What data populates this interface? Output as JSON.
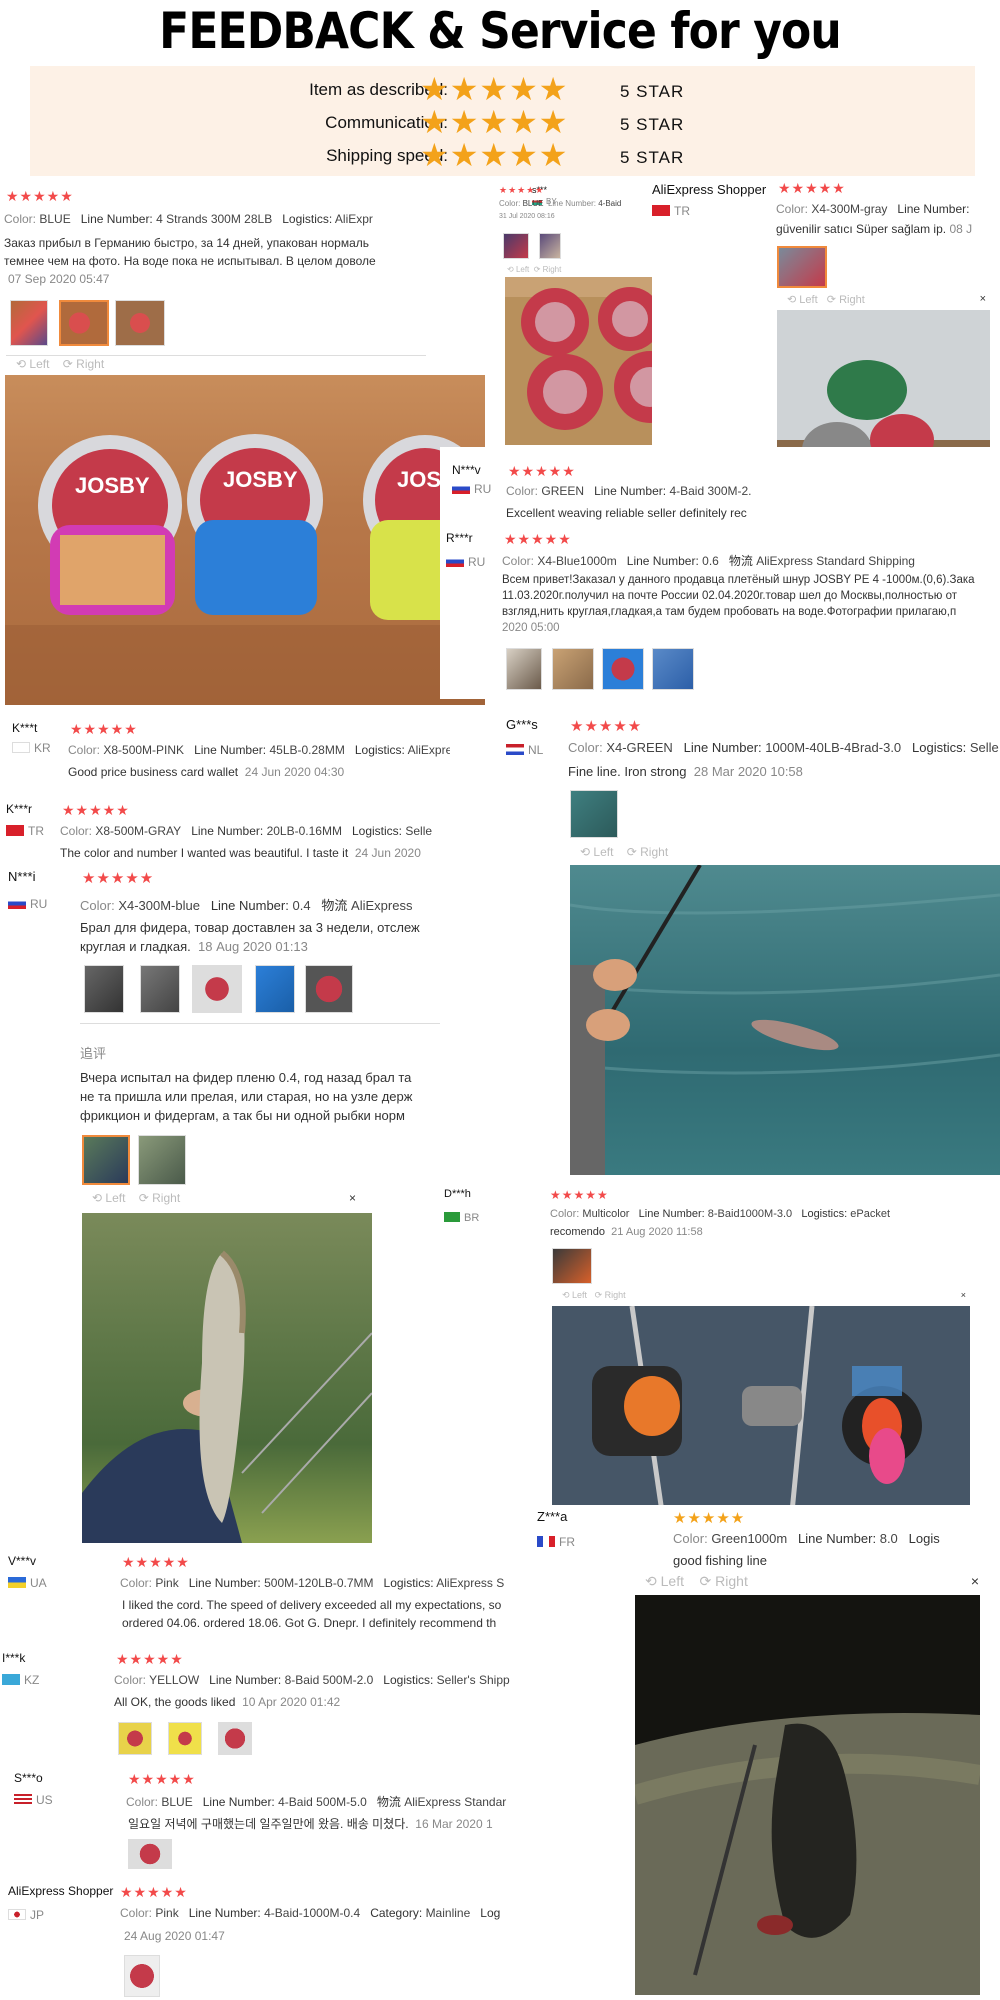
{
  "header": {
    "title": "FEEDBACK & Service for you",
    "rows": [
      {
        "label": "Item as described:",
        "stars": "★★★★★",
        "value": "5 STAR"
      },
      {
        "label": "Communication:",
        "stars": "★★★★★",
        "value": "5 STAR"
      },
      {
        "label": "Shipping speed:",
        "stars": "★★★★★",
        "value": "5 STAR"
      }
    ]
  },
  "stars5": "★★★★★",
  "controls": {
    "left": "Left",
    "right": "Right",
    "close": "×"
  },
  "colors": {
    "accent": "#f24a4a",
    "gold": "#f3a21a",
    "header_bg": "#fdf1e6"
  },
  "r1": {
    "color_label": "Color:",
    "color": "BLUE",
    "line_label": "Line Number:",
    "line": "4 Strands 300M 28LB",
    "log_label": "Logistics:",
    "log": "AliExpr",
    "text1": "Заказ прибыл в Германию быстро, за 14 дней, упакован нормаль",
    "text2": "темнее чем на фото. На воде пока не испытывал. В целом доволе",
    "date": "07 Sep 2020 05:47"
  },
  "r2": {
    "user": "s***",
    "cc": "BY",
    "color_label": "Color:",
    "color": "BLUE",
    "line_label": "Line Number:",
    "line": "4-Baid",
    "date": "31 Jul 2020 08:16"
  },
  "r3": {
    "user": "AliExpress Shopper",
    "cc": "TR",
    "color_label": "Color:",
    "color": "X4-300M-gray",
    "line_label": "Line Number:",
    "text": "güvenilir satıcı Süper sağlam ip.",
    "date": "08 J"
  },
  "r4": {
    "user": "N***v",
    "cc": "RU",
    "color_label": "Color:",
    "color": "GREEN",
    "line_label": "Line Number:",
    "line": "4-Baid 300M-2.",
    "text": "Excellent weaving reliable seller definitely rec"
  },
  "r5": {
    "user": "R***r",
    "cc": "RU",
    "color_label": "Color:",
    "color": "X4-Blue1000m",
    "line_label": "Line Number:",
    "line": "0.6",
    "log_label": "物流",
    "log": "AliExpress Standard Shipping",
    "text1": "Всем привет!Заказал у данного продавца плетёный шнур JOSBY PE 4 -1000м.(0,6).Зака",
    "text2": "11.03.2020г.получил на почте России 02.04.2020г.товар шел до Москвы,полностью от",
    "text3": "взгляд,нить круглая,гладкая,а там будем пробовать на воде.Фотографии прилагаю,п",
    "date": "2020 05:00"
  },
  "r6": {
    "user": "K***t",
    "cc": "KR",
    "color_label": "Color:",
    "color": "X8-500M-PINK",
    "line_label": "Line Number:",
    "line": "45LB-0.28MM",
    "log_label": "Logistics:",
    "log": "AliExpress S",
    "text": "Good price business card wallet",
    "date": "24 Jun 2020 04:30"
  },
  "r7": {
    "user": "G***s",
    "cc": "NL",
    "color_label": "Color:",
    "color": "X4-GREEN",
    "line_label": "Line Number:",
    "line": "1000M-40LB-4Brad-3.0",
    "log_label": "Logistics:",
    "log": "Selle",
    "text": "Fine line. Iron strong",
    "date": "28 Mar 2020 10:58"
  },
  "r8": {
    "user": "K***r",
    "cc": "TR",
    "color_label": "Color:",
    "color": "X8-500M-GRAY",
    "line_label": "Line Number:",
    "line": "20LB-0.16MM",
    "log_label": "Logistics:",
    "log": "Selle",
    "text": "The color and number I wanted was beautiful. I taste it",
    "date": "24 Jun 2020"
  },
  "r9": {
    "user": "N***i",
    "cc": "RU",
    "color_label": "Color:",
    "color": "X4-300M-blue",
    "line_label": "Line Number:",
    "line": "0.4",
    "log_label": "物流",
    "log": "AliExpress",
    "text1": "Брал для фидера, товар доставлен за 3 недели, отслеж",
    "text2": "круглая и гладкая.",
    "date": "18 Aug 2020 01:13",
    "followup": "追评",
    "f1": "Вчера испытал на фидер пленю 0.4, год назад брал та",
    "f2": "не та пришла или прелая, или старая, но на узле держ",
    "f3": "фрикцион и фидергам, а так бы ни одной рыбки норм"
  },
  "r10": {
    "user": "D***h",
    "cc": "BR",
    "color_label": "Color:",
    "color": "Multicolor",
    "line_label": "Line Number:",
    "line": "8-Baid1000M-3.0",
    "log_label": "Logistics:",
    "log": "ePacket",
    "text": "recomendo",
    "date": "21 Aug 2020 11:58"
  },
  "r11": {
    "user": "Z***a",
    "cc": "FR",
    "color_label": "Color:",
    "color": "Green1000m",
    "line_label": "Line Number:",
    "line": "8.0",
    "log_label": "Logis",
    "text": "good fishing line"
  },
  "r12": {
    "user": "V***v",
    "cc": "UA",
    "color_label": "Color:",
    "color": "Pink",
    "line_label": "Line Number:",
    "line": "500M-120LB-0.7MM",
    "log_label": "Logistics:",
    "log": "AliExpress S",
    "text1": "I liked the cord. The speed of delivery exceeded all my expectations, so",
    "text2": "ordered 04.06. ordered 18.06. Got G. Dnepr. I definitely recommend th"
  },
  "r13": {
    "user": "I***k",
    "cc": "KZ",
    "color_label": "Color:",
    "color": "YELLOW",
    "line_label": "Line Number:",
    "line": "8-Baid 500M-2.0",
    "log_label": "Logistics:",
    "log": "Seller's Shipp",
    "text": "All OK, the goods liked",
    "date": "10 Apr 2020 01:42"
  },
  "r14": {
    "user": "S***o",
    "cc": "US",
    "color_label": "Color:",
    "color": "BLUE",
    "line_label": "Line Number:",
    "line": "4-Baid 500M-5.0",
    "log_label": "物流",
    "log": "AliExpress Standar",
    "text": "일요일 저녁에 구매했는데 일주일만에 왔음. 배송 미쳤다.",
    "date": "16 Mar 2020 1"
  },
  "r15": {
    "user": "AliExpress Shopper",
    "cc": "JP",
    "color_label": "Color:",
    "color": "Pink",
    "line_label": "Line Number:",
    "line": "4-Baid-1000M-0.4",
    "cat_label": "Category:",
    "cat": "Mainline",
    "log_label": "Log",
    "date": "24 Aug 2020 01:47"
  }
}
